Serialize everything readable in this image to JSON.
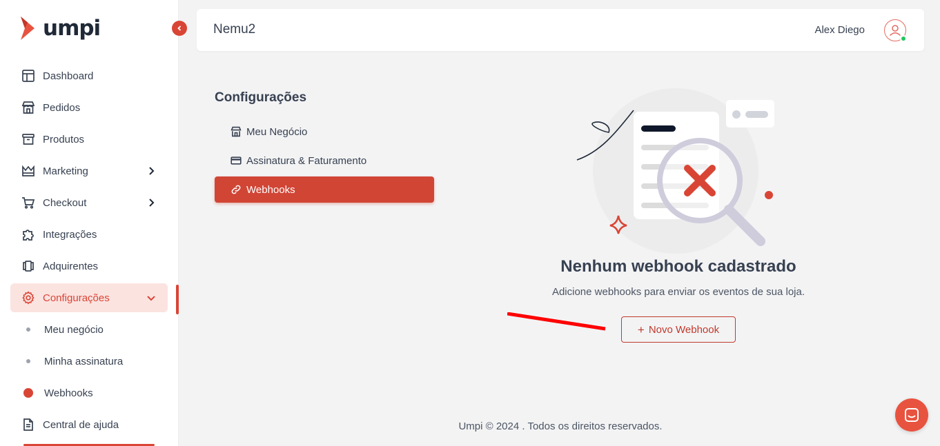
{
  "brand": {
    "name": "umpi",
    "accent": "#d94535"
  },
  "sidebar": {
    "items": [
      {
        "label": "Dashboard",
        "icon": "layout-icon"
      },
      {
        "label": "Pedidos",
        "icon": "store-icon"
      },
      {
        "label": "Produtos",
        "icon": "archive-icon"
      },
      {
        "label": "Marketing",
        "icon": "crown-icon"
      },
      {
        "label": "Checkout",
        "icon": "cart-icon"
      },
      {
        "label": "Integrações",
        "icon": "puzzle-icon"
      },
      {
        "label": "Adquirentes",
        "icon": "cards-icon"
      },
      {
        "label": "Configurações",
        "icon": "gear-icon"
      }
    ],
    "subitems": [
      {
        "label": "Meu negócio"
      },
      {
        "label": "Minha assinatura"
      },
      {
        "label": "Webhooks"
      }
    ],
    "help": {
      "label": "Central de ajuda",
      "icon": "document-icon"
    }
  },
  "header": {
    "store_name": "Nemu2",
    "user_name": "Alex Diego"
  },
  "settings": {
    "title": "Configurações",
    "items": [
      {
        "label": "Meu Negócio",
        "icon": "store-icon"
      },
      {
        "label": "Assinatura & Faturamento",
        "icon": "credit-card-icon"
      },
      {
        "label": "Webhooks",
        "icon": "link-icon"
      }
    ]
  },
  "empty_state": {
    "title": "Nenhum webhook cadastrado",
    "subtitle": "Adicione webhooks para enviar os eventos de sua loja.",
    "button_label": "Novo Webhook"
  },
  "footer": {
    "text": "Umpi © 2024 . Todos os direitos reservados."
  }
}
